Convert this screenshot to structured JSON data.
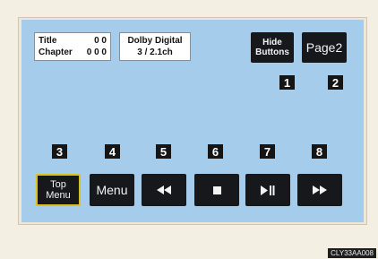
{
  "info": {
    "title_label": "Title",
    "title_value": "0 0",
    "chapter_label": "Chapter",
    "chapter_value": "0 0 0",
    "audio_format": "Dolby Digital",
    "audio_channels": "3 / 2.1ch"
  },
  "buttons": {
    "hide_line1": "Hide",
    "hide_line2": "Buttons",
    "page2": "Page2",
    "top_menu_line1": "Top",
    "top_menu_line2": "Menu",
    "menu": "Menu"
  },
  "icons": {
    "rewind": "rewind-icon",
    "stop": "stop-icon",
    "play_pause": "play-pause-icon",
    "fast_forward": "fast-forward-icon"
  },
  "callouts": [
    "1",
    "2",
    "3",
    "4",
    "5",
    "6",
    "7",
    "8"
  ],
  "image_code": "CLY33AA008",
  "colors": {
    "screen": "#a6ccec",
    "button": "#16181b",
    "highlight_border": "#d8c21a"
  }
}
